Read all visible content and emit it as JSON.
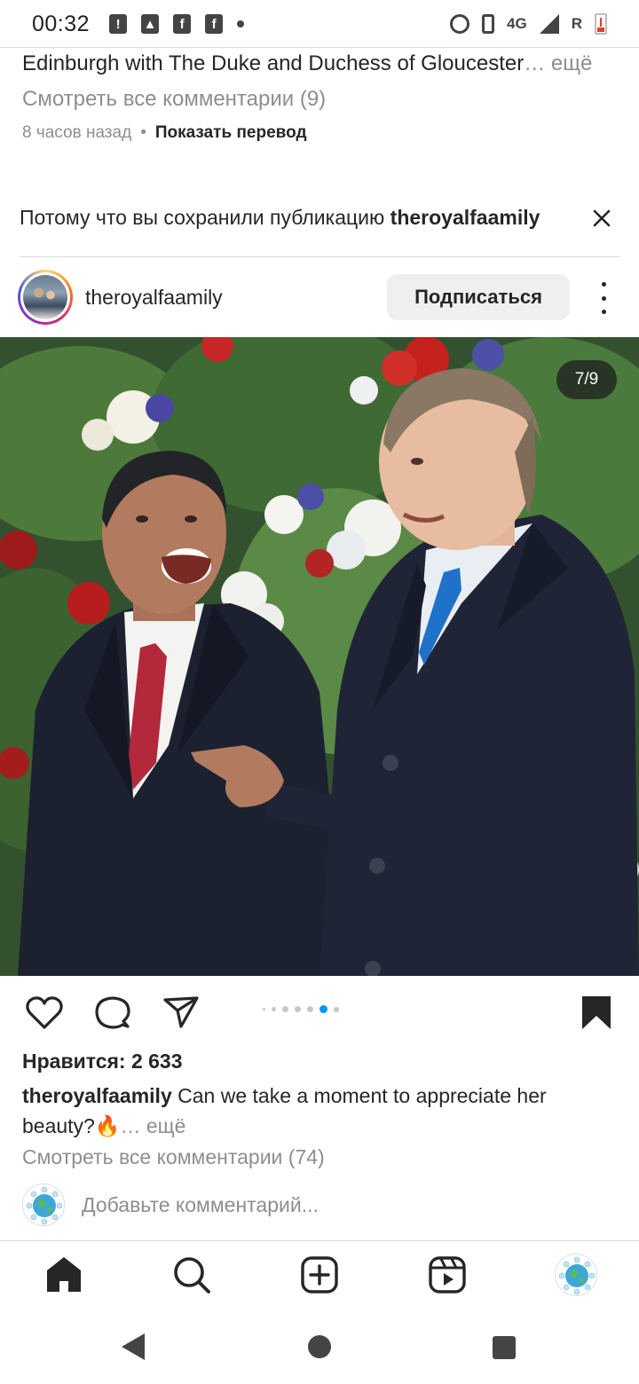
{
  "status_bar": {
    "time": "00:32",
    "network": "4G",
    "roaming": "R",
    "left_icons": [
      "notification-alert-icon",
      "gallery-icon",
      "facebook-icon",
      "facebook-icon",
      "more-dot-icon"
    ],
    "right_icons": [
      "alarm-icon",
      "vibrate-icon",
      "signal-icon",
      "battery-low-icon"
    ]
  },
  "previous_post": {
    "caption_text": "Edinburgh with The Duke and Duchess of Gloucester",
    "more": "… ещё",
    "view_comments": "Смотреть все комментарии (9)",
    "time_ago": "8 часов назад",
    "separator": "•",
    "translate": "Показать перевод"
  },
  "suggestion": {
    "text": "Потому что вы сохранили публикацию",
    "account": "theroyalfaamily"
  },
  "post": {
    "username": "theroyalfaamily",
    "follow_label": "Подписаться",
    "photo_counter": "7/9",
    "carousel": {
      "total_dots": 7,
      "active_index": 5
    },
    "likes": "Нравится: 2 633",
    "caption_user": "theroyalfaamily",
    "caption_text": "Can we take a moment to appreciate her beauty?",
    "caption_emoji": "🔥",
    "caption_more": "… ещё",
    "view_comments": "Смотреть все комментарии (74)",
    "comment_placeholder": "Добавьте комментарий...",
    "saved": true
  },
  "bottom_nav": {
    "items": [
      "home-icon",
      "search-icon",
      "create-icon",
      "reels-icon",
      "profile-avatar"
    ],
    "active": "home-icon"
  },
  "colors": {
    "text": "#262626",
    "secondary": "#8e8e8e",
    "active_dot": "#0095f6",
    "follow_bg": "#efefef"
  }
}
